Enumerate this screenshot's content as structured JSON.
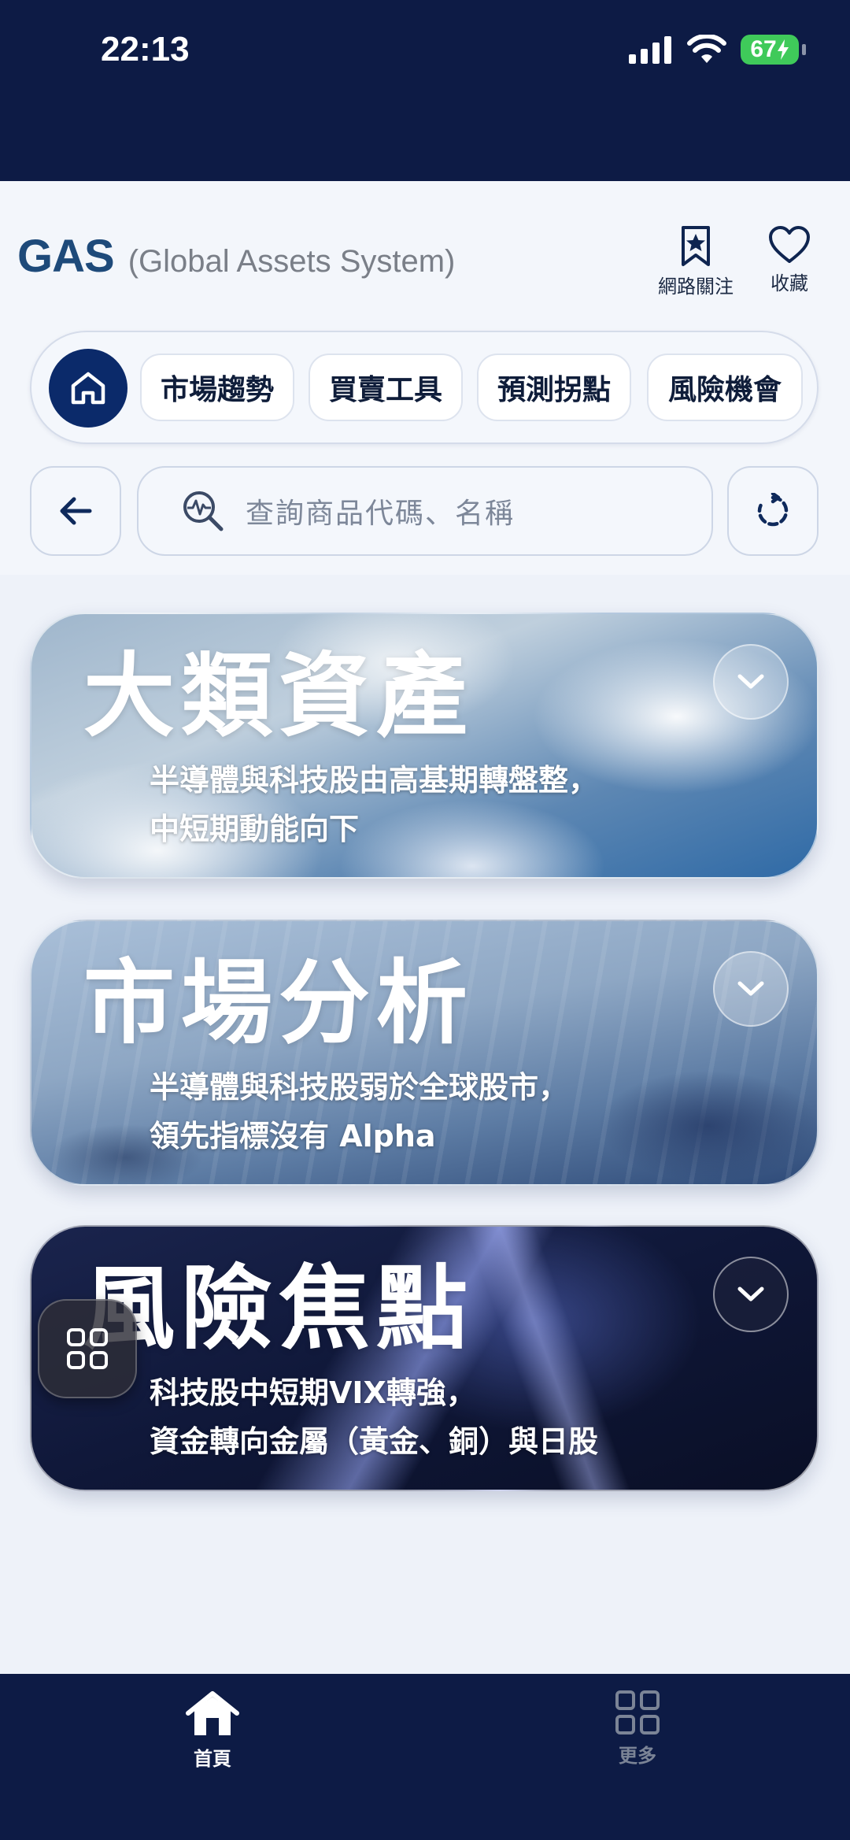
{
  "status_bar": {
    "time": "22:13",
    "battery": "67"
  },
  "header": {
    "brand_name": "GAS",
    "brand_subtitle": "(Global Assets System)",
    "actions": [
      {
        "label": "網路關注",
        "icon": "bookmark-star-icon"
      },
      {
        "label": "收藏",
        "icon": "heart-icon"
      }
    ]
  },
  "nav": {
    "home_icon": "home-icon",
    "pills": [
      "市場趨勢",
      "買賣工具",
      "預測拐點",
      "風險機會"
    ]
  },
  "search": {
    "placeholder": "查詢商品代碼、名稱"
  },
  "cards": [
    {
      "title": "大類資產",
      "desc_line1": "半導體與科技股由高基期轉盤整，",
      "desc_line2": "中短期動能向下"
    },
    {
      "title": "市場分析",
      "desc_line1": "半導體與科技股弱於全球股市，",
      "desc_line2": "領先指標沒有 Alpha"
    },
    {
      "title": "風險焦點",
      "desc_line1": "科技股中短期VIX轉強，",
      "desc_line2": "資金轉向金屬（黃金、銅）與日股"
    }
  ],
  "tabbar": {
    "tabs": [
      {
        "label": "首頁",
        "active": true
      },
      {
        "label": "更多",
        "active": false
      }
    ]
  },
  "colors": {
    "primary_dark": "#0d1b45",
    "accent": "#0b2a6a",
    "battery": "#3fca5a"
  }
}
